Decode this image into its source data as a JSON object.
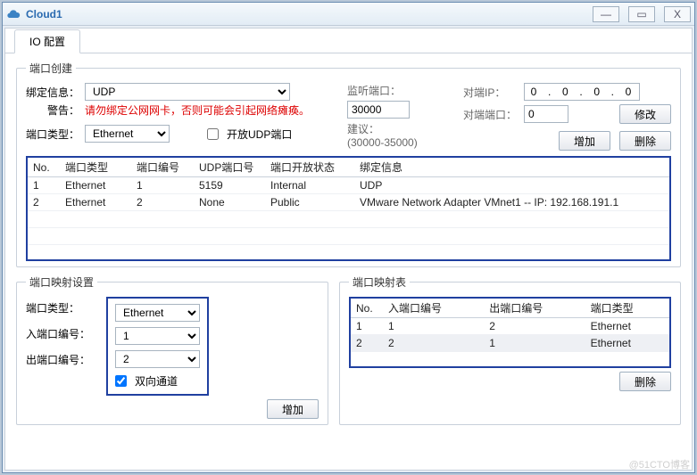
{
  "window": {
    "title": "Cloud1"
  },
  "tabs": {
    "io": "IO 配置"
  },
  "portCreate": {
    "legend": "端口创建",
    "bindInfoLabel": "绑定信息：",
    "bindInfoValue": "UDP",
    "warningLabel": "警告：",
    "warningText": "请勿绑定公网网卡，否则可能会引起网络瘫痪。",
    "portTypeLabel": "端口类型：",
    "portTypeValue": "Ethernet",
    "openUdpLabel": "开放UDP端口",
    "listenPortLabel": "监听端口：",
    "listenPortValue": "30000",
    "suggestLabel": "建议：",
    "suggestRange": "(30000-35000)",
    "peerIpLabel": "对端IP：",
    "peerIpValue": "0  .  0  .  0  .  0",
    "peerPortLabel": "对端端口：",
    "peerPortValue": "0",
    "modifyBtn": "修改",
    "addBtn": "增加",
    "deleteBtn": "删除",
    "cols": {
      "no": "No.",
      "type": "端口类型",
      "num": "端口编号",
      "udp": "UDP端口号",
      "open": "端口开放状态",
      "bind": "绑定信息"
    },
    "rows": [
      {
        "no": "1",
        "type": "Ethernet",
        "num": "1",
        "udp": "5159",
        "open": "Internal",
        "bind": "UDP"
      },
      {
        "no": "2",
        "type": "Ethernet",
        "num": "2",
        "udp": "None",
        "open": "Public",
        "bind": "VMware Network Adapter VMnet1 -- IP: 192.168.191.1"
      }
    ]
  },
  "mapSettings": {
    "legend": "端口映射设置",
    "portTypeLabel": "端口类型：",
    "portTypeValue": "Ethernet",
    "inPortLabel": "入端口编号：",
    "inPortValue": "1",
    "outPortLabel": "出端口编号：",
    "outPortValue": "2",
    "bidirLabel": "双向通道",
    "addBtn": "增加"
  },
  "mapTable": {
    "legend": "端口映射表",
    "cols": {
      "no": "No.",
      "in": "入端口编号",
      "out": "出端口编号",
      "type": "端口类型"
    },
    "rows": [
      {
        "no": "1",
        "in": "1",
        "out": "2",
        "type": "Ethernet"
      },
      {
        "no": "2",
        "in": "2",
        "out": "1",
        "type": "Ethernet"
      }
    ],
    "deleteBtn": "删除"
  },
  "watermark": "@51CTO博客"
}
